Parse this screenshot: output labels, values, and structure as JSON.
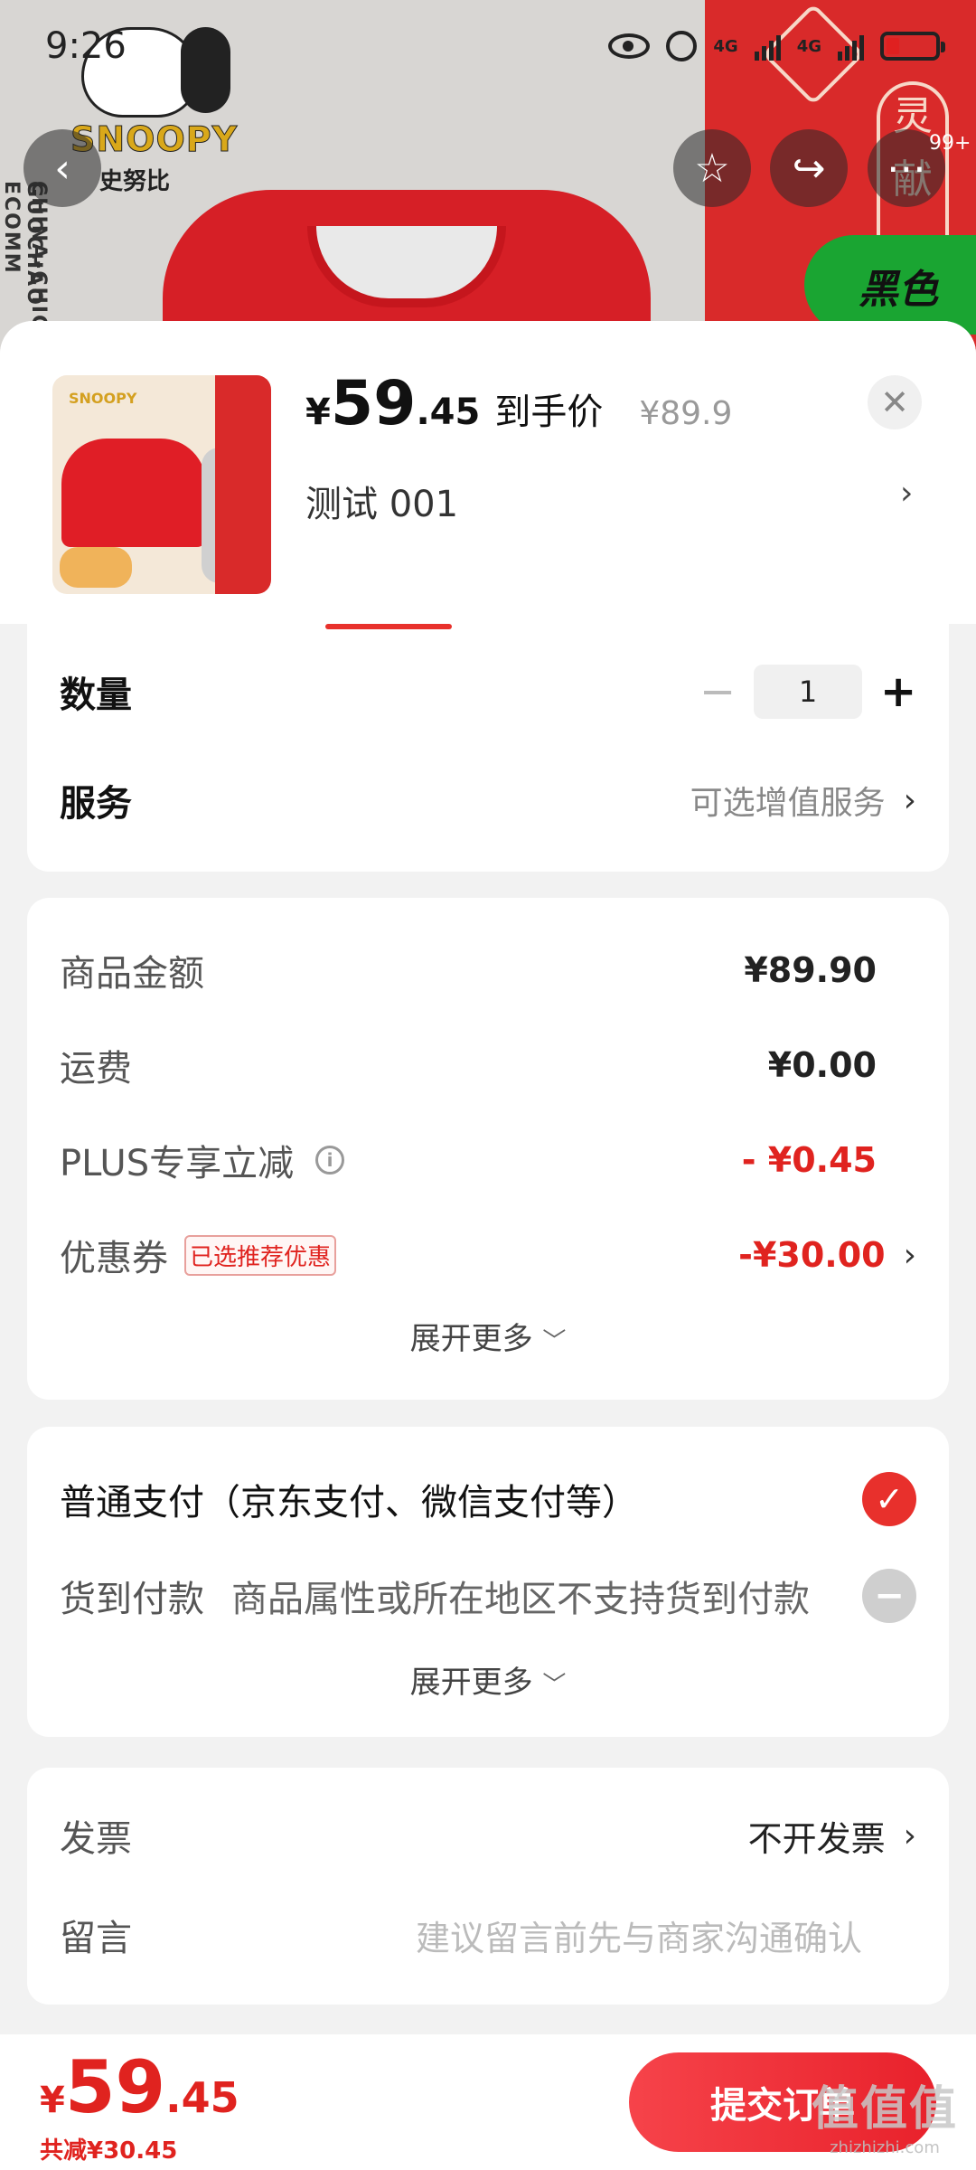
{
  "status_bar": {
    "time": "9:26",
    "net1": "4G",
    "net2": "4G"
  },
  "background": {
    "brand": "SNOOPY",
    "brand_cn": "史努比",
    "vertical_text_1": "CHINA-CHIC S",
    "vertical_text_2": "GUOCHAO ECOMM",
    "deco_chars": "灵\n献",
    "color_tag": "黑色",
    "notification_count": "99+"
  },
  "product": {
    "currency": "¥",
    "price_int": "59",
    "price_dec": ".45",
    "price_label": "到手价",
    "original_price": "¥89.9",
    "sku": "测试  001",
    "close_icon": "close-icon"
  },
  "options": {
    "quantity_label": "数量",
    "quantity_value": "1",
    "service_label": "服务",
    "service_value": "可选增值服务"
  },
  "fees": {
    "goods_label": "商品金额",
    "goods_value": "¥89.90",
    "shipping_label": "运费",
    "shipping_value": "¥0.00",
    "plus_label": "PLUS专享立减",
    "plus_value": "- ¥0.45",
    "coupon_label": "优惠券",
    "coupon_tag": "已选推荐优惠",
    "coupon_value": "-¥30.00",
    "expand_label": "展开更多"
  },
  "payment": {
    "normal_label": "普通支付（京东支付、微信支付等）",
    "cod_label": "货到付款",
    "cod_note": "商品属性或所在地区不支持货到付款",
    "expand_label": "展开更多"
  },
  "extra": {
    "invoice_label": "发票",
    "invoice_value": "不开发票",
    "remark_label": "留言",
    "remark_placeholder": "建议留言前先与商家沟通确认"
  },
  "footer": {
    "currency": "¥",
    "total_int": "59",
    "total_dec": ".45",
    "saved": "共减¥30.45",
    "submit_label": "提交订单",
    "watermark": "值值值",
    "watermark_url": "zhizhizhi.com"
  },
  "colors": {
    "accent": "#e0231f",
    "submit_gradient_start": "#f6434a",
    "submit_gradient_end": "#e8212b",
    "tag_green": "#1aa532"
  }
}
